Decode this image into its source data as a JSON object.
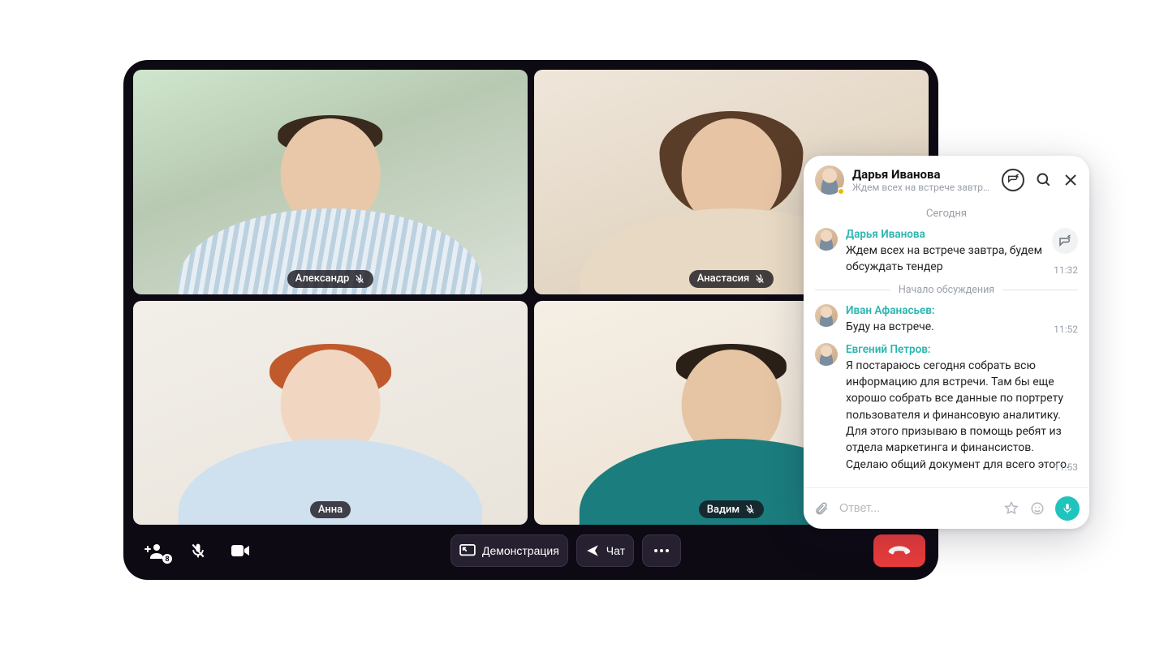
{
  "participants": [
    {
      "name": "Александр",
      "muted": true
    },
    {
      "name": "Анастасия",
      "muted": true
    },
    {
      "name": "Анна",
      "muted": false
    },
    {
      "name": "Вадим",
      "muted": true
    }
  ],
  "toolbar": {
    "participant_count": "8",
    "screenshare_label": "Демонстрация",
    "chat_label": "Чат"
  },
  "chat": {
    "header": {
      "name": "Дарья Иванова",
      "subtitle": "Ждем всех на встрече завтра..."
    },
    "day_label": "Сегодня",
    "thread_label": "Начало обсуждения",
    "input_placeholder": "Ответ...",
    "messages": [
      {
        "author": "Дарья Иванова",
        "text": "Ждем всех на встрече завтра, будем обсуждать тендер",
        "time": "11:32"
      },
      {
        "author": "Иван Афанасьев:",
        "text": "Буду на встрече.",
        "time": "11:52"
      },
      {
        "author": "Евгений Петров:",
        "text": "Я постараюсь сегодня собрать всю информацию для встречи. Там бы еще хорошо собрать все данные по портрету пользователя и финансовую аналитику. Для этого призываю в помощь ребят из отдела маркетинга и финансистов. Сделаю общий документ для всего этого.",
        "time": "11:53"
      }
    ]
  }
}
